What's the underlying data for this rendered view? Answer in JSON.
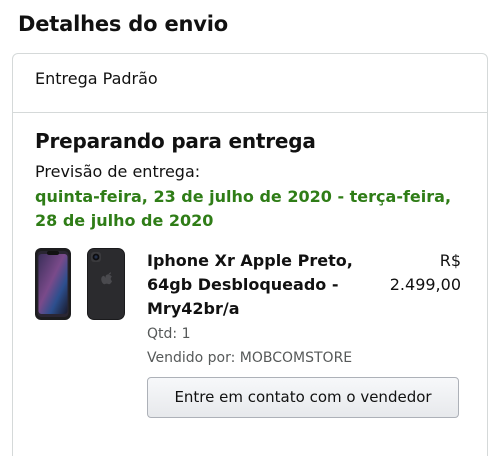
{
  "section": {
    "title": "Detalhes do envio"
  },
  "shipment": {
    "type": "Entrega Padrão",
    "status": "Preparando para entrega",
    "forecast_label": "Previsão de entrega:",
    "forecast_date": "quinta-feira, 23 de julho de 2020 - terça-feira, 28 de julho de 2020",
    "status_color": "#2f7d17"
  },
  "product": {
    "name": "Iphone Xr Apple Preto, 64gb Desbloqueado - Mry42br/a",
    "price_currency": "R$",
    "price_value": "2.499,00",
    "quantity": "Qtd: 1",
    "seller": "Vendido por: MOBCOMSTORE",
    "image_icon": "phone-image"
  },
  "actions": {
    "contact_seller": "Entre em contato com o vendedor"
  }
}
